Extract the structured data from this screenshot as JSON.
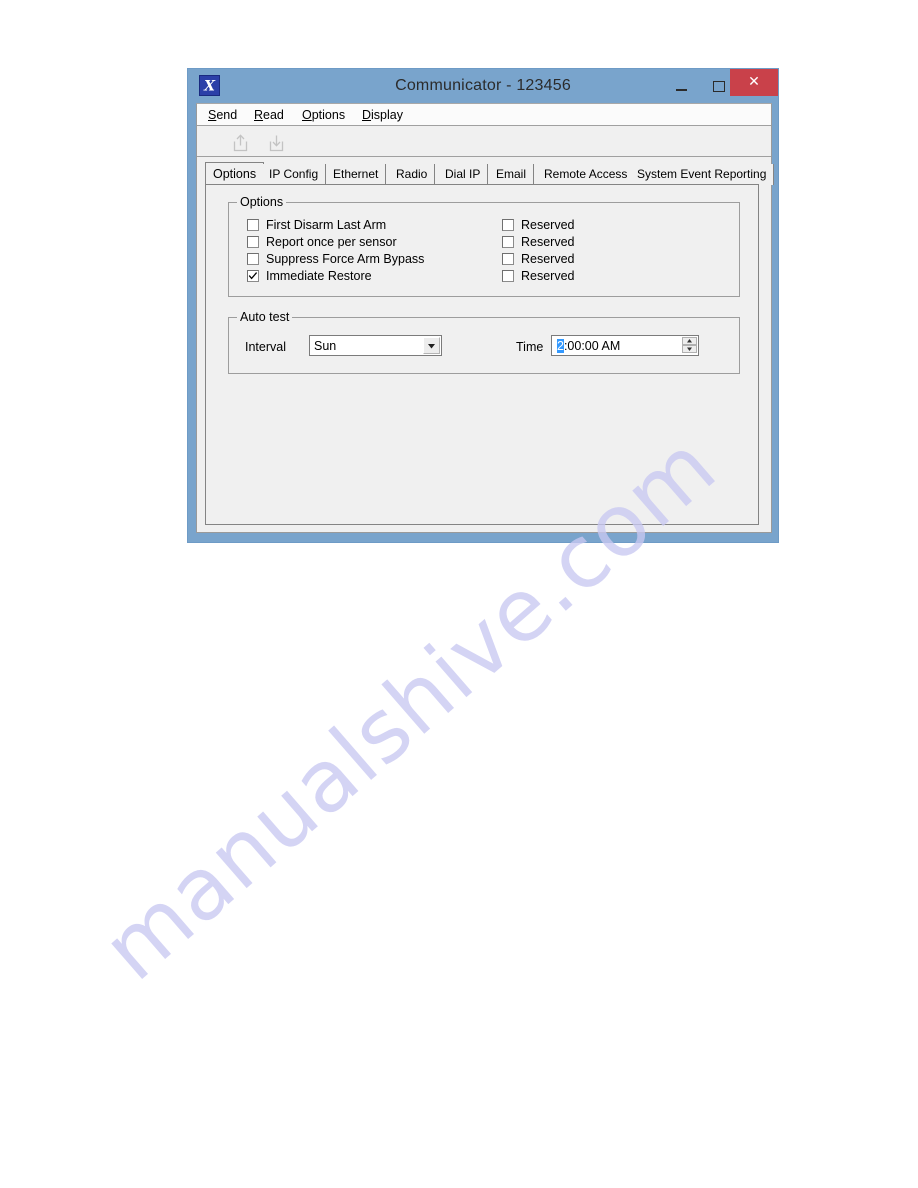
{
  "window": {
    "title": "Communicator - 123456",
    "app_icon": "x-logo-icon",
    "titlebar_color": "#79a4cc",
    "close_button_color": "#c9414a",
    "controls": {
      "minimize": "Minimize",
      "maximize": "Maximize",
      "close": "Close"
    }
  },
  "menubar": {
    "items": [
      {
        "label": "Send",
        "accel": "S",
        "rest": "end"
      },
      {
        "label": "Read",
        "accel": "R",
        "rest": "ead"
      },
      {
        "label": "Options",
        "accel": "O",
        "rest": "ptions"
      },
      {
        "label": "Display",
        "accel": "D",
        "rest": "isplay"
      }
    ]
  },
  "toolbar": {
    "buttons": [
      {
        "name": "send-to-panel",
        "icon": "upload-arrow-icon",
        "enabled": false
      },
      {
        "name": "read-from-panel",
        "icon": "download-arrow-icon",
        "enabled": false
      }
    ]
  },
  "tabs": {
    "active_index": 0,
    "items": [
      {
        "label": "Options"
      },
      {
        "label": "IP Config"
      },
      {
        "label": "Ethernet"
      },
      {
        "label": "Radio"
      },
      {
        "label": "Dial IP"
      },
      {
        "label": "Email"
      },
      {
        "label": "Remote Access"
      },
      {
        "label": "System Event Reporting"
      }
    ]
  },
  "options_group": {
    "legend": "Options",
    "left_column": [
      {
        "label": "First Disarm Last Arm",
        "checked": false
      },
      {
        "label": "Report once per sensor",
        "checked": false
      },
      {
        "label": "Suppress Force Arm Bypass",
        "checked": false
      },
      {
        "label": "Immediate Restore",
        "checked": true
      }
    ],
    "right_column": [
      {
        "label": "Reserved",
        "checked": false
      },
      {
        "label": "Reserved",
        "checked": false
      },
      {
        "label": "Reserved",
        "checked": false
      },
      {
        "label": "Reserved",
        "checked": false
      }
    ]
  },
  "autotest_group": {
    "legend": "Auto test",
    "interval_label": "Interval",
    "interval_value": "Sun",
    "time_label": "Time",
    "time_selected": "2",
    "time_rest": ":00:00 AM",
    "time_value": "2:00:00 AM"
  },
  "watermark": {
    "text": "manualshive.com",
    "color": "#c9c9f2"
  }
}
